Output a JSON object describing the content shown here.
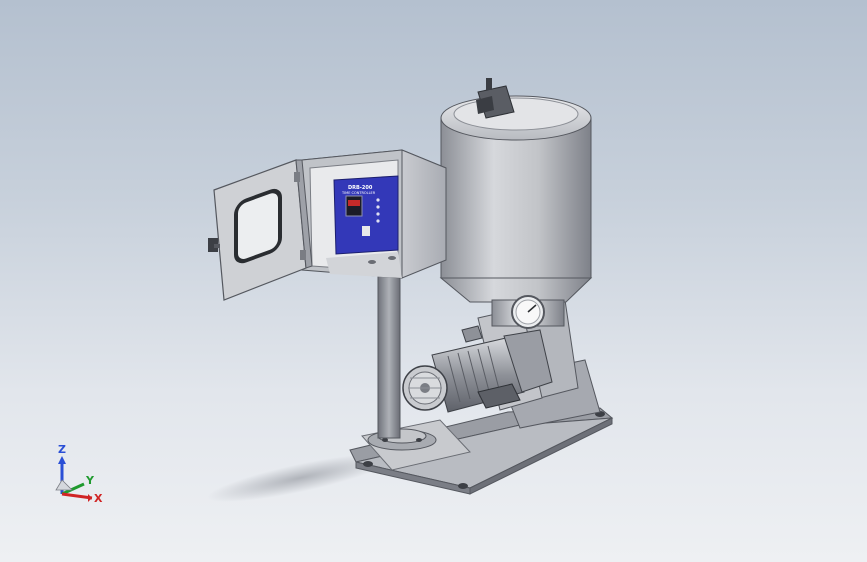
{
  "viewport": {
    "background": [
      "#b4c0cf",
      "#eef0f3"
    ]
  },
  "model": {
    "controller_label_line1": "DRB-200",
    "controller_label_line2": "TIME CONTROLLER",
    "controller_color": "#3338b8",
    "gauge_reading": ""
  },
  "triad": {
    "z": "Z",
    "y": "Y",
    "x": "X",
    "colors": {
      "z": "#2a4fd6",
      "y": "#1f9a2e",
      "x": "#d02424"
    }
  }
}
